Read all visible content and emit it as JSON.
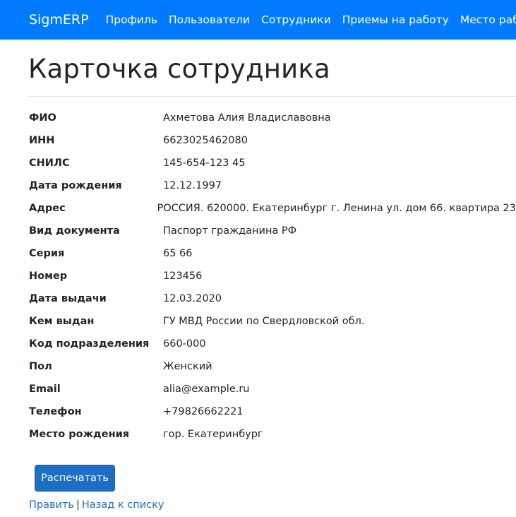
{
  "navbar": {
    "brand": "SigmERP",
    "links": [
      "Профиль",
      "Пользователи",
      "Сотрудники",
      "Приемы на работу",
      "Место работы"
    ]
  },
  "page": {
    "title": "Карточка сотрудника"
  },
  "employee": {
    "fields": [
      {
        "label": "ФИО",
        "value": "Ахметова Алия Владиславовна"
      },
      {
        "label": "ИНН",
        "value": "6623025462080"
      },
      {
        "label": "СНИЛС",
        "value": "145-654-123 45"
      },
      {
        "label": "Дата рождения",
        "value": "12.12.1997"
      },
      {
        "label": "Адрес",
        "value": "РОССИЯ. 620000. Екатеринбург г. Ленина ул. дом 66. квартира 23"
      },
      {
        "label": "Вид документа",
        "value": "Паспорт гражданина РФ"
      },
      {
        "label": "Серия",
        "value": "65 66"
      },
      {
        "label": "Номер",
        "value": "123456"
      },
      {
        "label": "Дата выдачи",
        "value": "12.03.2020"
      },
      {
        "label": "Кем выдан",
        "value": "ГУ МВД России по Свердловской обл."
      },
      {
        "label": "Код подразделения",
        "value": "660-000"
      },
      {
        "label": "Пол",
        "value": "Женский"
      },
      {
        "label": "Email",
        "value": "alia@example.ru"
      },
      {
        "label": "Телефон",
        "value": "+79826662221"
      },
      {
        "label": "Место рождения",
        "value": "гор. Екатеринбург"
      }
    ]
  },
  "actions": {
    "print_label": "Распечатать",
    "edit_label": "Править",
    "separator": "|",
    "back_label": "Назад к списку"
  },
  "colors": {
    "navbar": "#007bff",
    "button": "#1e6ec5",
    "link": "#1e6ec5"
  }
}
